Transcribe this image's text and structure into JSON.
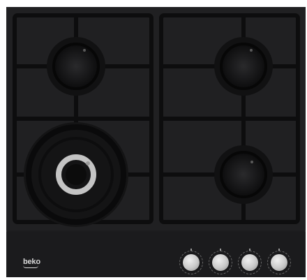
{
  "appliance": {
    "brand": "beko",
    "burner_count": 4,
    "knob_count": 4
  },
  "colors": {
    "glass": "#1c1c1e",
    "grate": "#0f0f10",
    "burner_ring_highlight": "#c8c8c8",
    "knob_cap": "#cfcfcf",
    "brand_text": "#d8d8d8"
  },
  "icons": [
    "burner-icon",
    "wok-burner-icon",
    "control-knob-icon"
  ]
}
